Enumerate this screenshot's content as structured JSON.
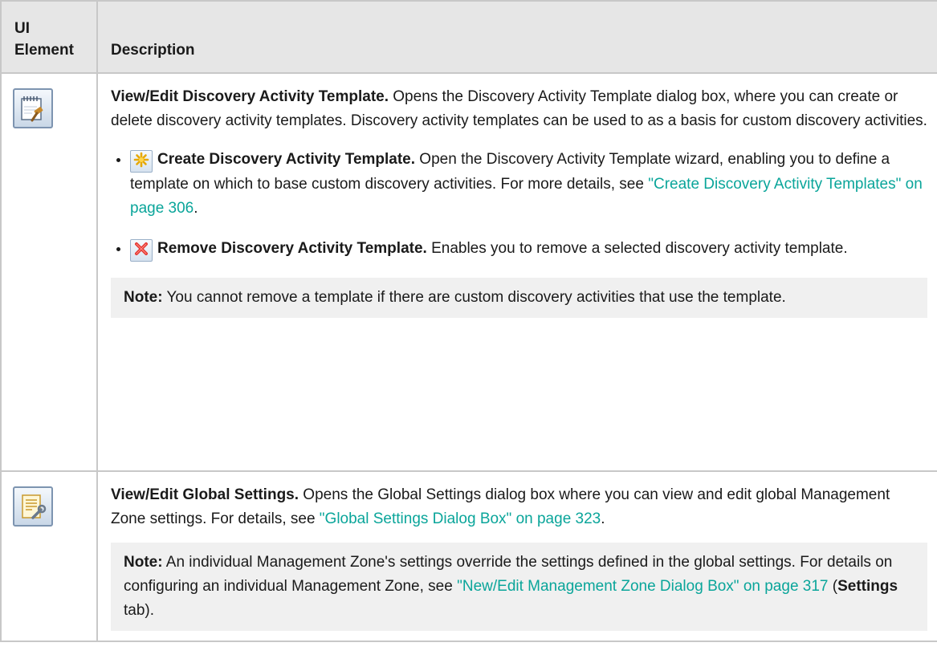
{
  "header": {
    "col1": "UI Element",
    "col2": "Description"
  },
  "rows": [
    {
      "icon": "template-notepad-hammer-icon",
      "title": "View/Edit Discovery Activity Template.",
      "text": " Opens the Discovery Activity Template dialog box, where you can create or delete discovery activity templates. Discovery activity templates can be used to as a basis for custom discovery activities.",
      "bullets": [
        {
          "icon": "create-star-icon",
          "title": "Create Discovery Activity Template.",
          "text": " Open the Discovery Activity Template wizard, enabling you to define a template on which to base custom discovery activities. For more details, see ",
          "link": "\"Create Discovery Activity Templates\" on page 306",
          "after": "."
        },
        {
          "icon": "remove-x-icon",
          "title": "Remove Discovery Activity Template.",
          "text": " Enables you to remove a selected discovery activity template."
        }
      ],
      "note": {
        "label": "Note:",
        "text": " You cannot remove a template if there are custom discovery activities that use the template."
      }
    },
    {
      "icon": "settings-list-wrench-icon",
      "title": "View/Edit Global Settings.",
      "text": " Opens the Global Settings dialog box where you can view and edit global Management Zone settings. For details, see ",
      "link": "\"Global Settings Dialog Box\" on page 323",
      "after": ".",
      "note": {
        "label": "Note:",
        "text": " An individual Management Zone's settings override the settings defined in the global settings. For details on configuring an individual Management Zone, see ",
        "link": "\"New/Edit Management Zone Dialog Box\" on page 317",
        "after_open": " (",
        "after_bold": "Settings",
        "after_close": " tab)."
      }
    }
  ]
}
